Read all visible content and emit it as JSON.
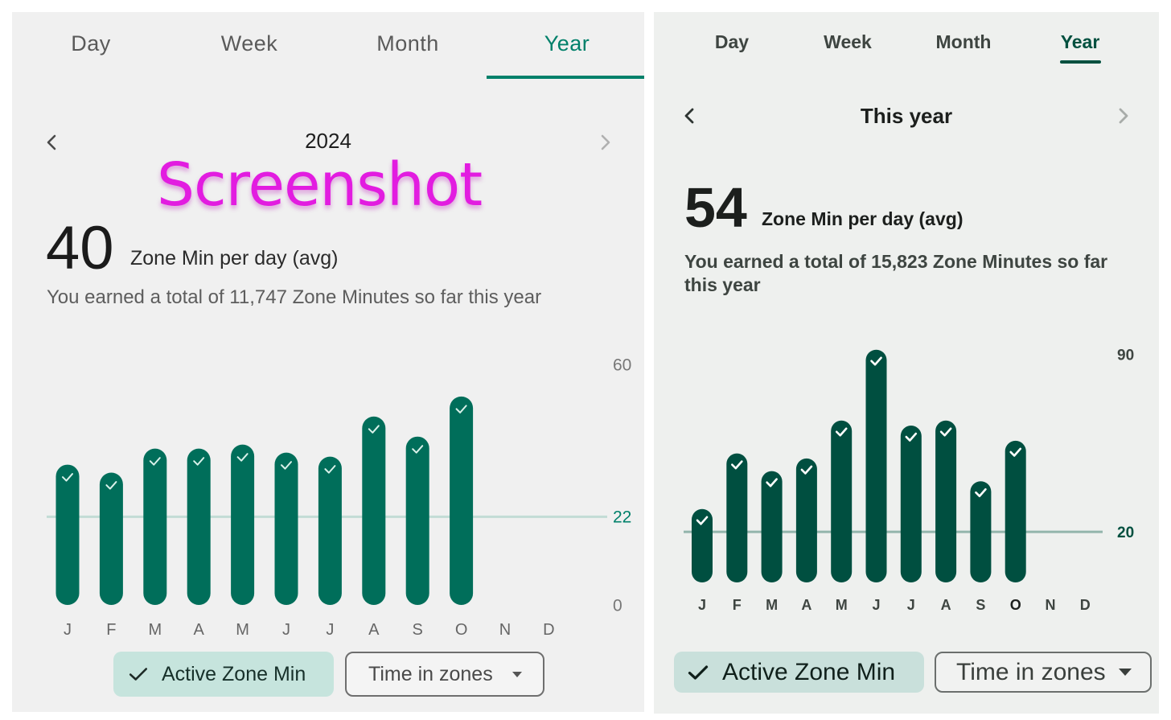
{
  "left": {
    "tabs": [
      {
        "label": "Day",
        "active": false
      },
      {
        "label": "Week",
        "active": false
      },
      {
        "label": "Month",
        "active": false
      },
      {
        "label": "Year",
        "active": true
      }
    ],
    "period_label": "2024",
    "watermark": "Screenshot",
    "avg_value": "40",
    "avg_unit": "Zone Min per day (avg)",
    "summary": "You earned a total of 11,747 Zone Minutes so far this year",
    "chips": {
      "active_label": "Active Zone Min",
      "dropdown_label": "Time in zones"
    },
    "colors": {
      "accent": "#00806a",
      "bar": "#006e5a",
      "goal_line": "#c2dcd5",
      "chip_bg": "#c6e4dd"
    }
  },
  "right": {
    "tabs": [
      {
        "label": "Day",
        "active": false
      },
      {
        "label": "Week",
        "active": false
      },
      {
        "label": "Month",
        "active": false
      },
      {
        "label": "Year",
        "active": true
      }
    ],
    "period_label": "This year",
    "avg_value": "54",
    "avg_unit": "Zone Min per day (avg)",
    "summary": "You earned a total of 15,823 Zone Minutes so far this year",
    "chips": {
      "active_label": "Active Zone Min",
      "dropdown_label": "Time in zones"
    },
    "colors": {
      "accent": "#00503f",
      "bar": "#004f40",
      "goal_line": "#93b5ac",
      "chip_bg": "#c9e0db"
    }
  },
  "chart_data": [
    {
      "type": "bar",
      "title": "2024",
      "categories": [
        "J",
        "F",
        "M",
        "A",
        "M",
        "J",
        "J",
        "A",
        "S",
        "O",
        "N",
        "D"
      ],
      "values": [
        35,
        33,
        39,
        39,
        40,
        38,
        37,
        47,
        42,
        52,
        null,
        null
      ],
      "goal_met": [
        true,
        true,
        true,
        true,
        true,
        true,
        true,
        true,
        true,
        true,
        false,
        false
      ],
      "goal_line": 22,
      "yticks": [
        0,
        22,
        60
      ],
      "ylim": [
        0,
        60
      ],
      "xlabel": "",
      "ylabel": "Zone Min per day (avg)",
      "legend": "none",
      "grid": false
    },
    {
      "type": "bar",
      "title": "This year",
      "categories": [
        "J",
        "F",
        "M",
        "A",
        "M",
        "J",
        "J",
        "A",
        "S",
        "O",
        "N",
        "D"
      ],
      "values": [
        29,
        51,
        44,
        49,
        64,
        92,
        62,
        64,
        40,
        56,
        null,
        null
      ],
      "goal_met": [
        true,
        true,
        true,
        true,
        true,
        true,
        true,
        true,
        true,
        true,
        false,
        false
      ],
      "goal_line": 20,
      "yticks": [
        20,
        90
      ],
      "ylim": [
        0,
        90
      ],
      "current_month_index": 9,
      "xlabel": "",
      "ylabel": "Zone Min per day (avg)",
      "legend": "none",
      "grid": false
    }
  ]
}
